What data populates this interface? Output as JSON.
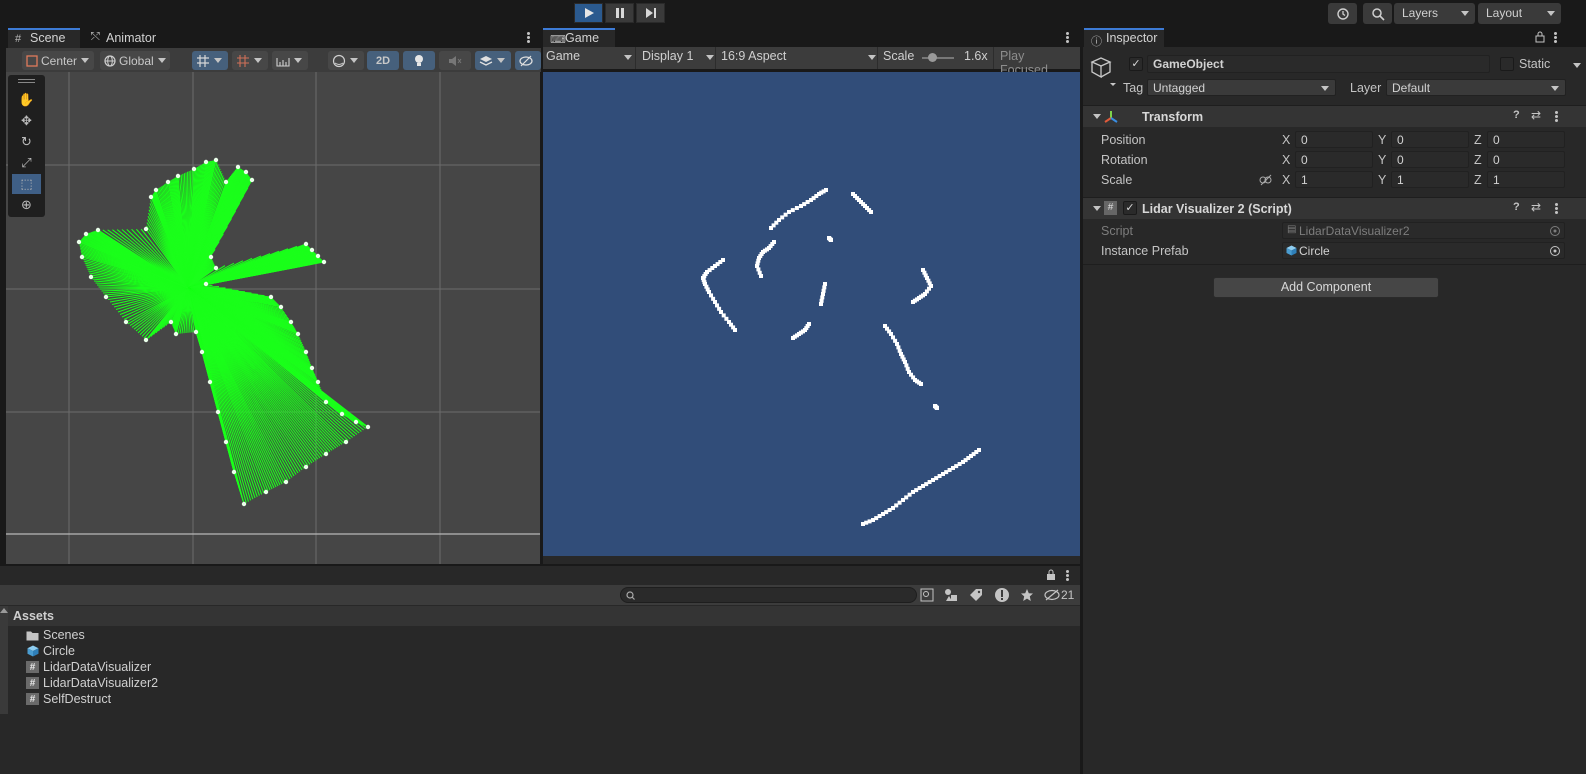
{
  "toolbar": {
    "play_controls": [
      "play",
      "pause",
      "step"
    ],
    "layers_label": "Layers",
    "layout_label": "Layout"
  },
  "scene_panel": {
    "tabs": [
      {
        "label": "Scene",
        "icon": "hash-icon"
      },
      {
        "label": "Animator",
        "icon": "animator-icon"
      }
    ],
    "pivot_label": "Center",
    "space_label": "Global",
    "mode_2d_label": "2D"
  },
  "game_panel": {
    "tab_label": "Game",
    "view_mode": "Game",
    "display": "Display 1",
    "aspect": "16:9 Aspect",
    "scale_label": "Scale",
    "scale_value": "1.6x",
    "play_focused": "Play Focused"
  },
  "inspector": {
    "tab_label": "Inspector",
    "object_name": "GameObject",
    "static_label": "Static",
    "tag_label": "Tag",
    "tag_value": "Untagged",
    "layer_label": "Layer",
    "layer_value": "Default",
    "transform": {
      "title": "Transform",
      "position_label": "Position",
      "rotation_label": "Rotation",
      "scale_label": "Scale",
      "axis_x": "X",
      "axis_y": "Y",
      "axis_z": "Z",
      "position": [
        "0",
        "0",
        "0"
      ],
      "rotation": [
        "0",
        "0",
        "0"
      ],
      "scale": [
        "1",
        "1",
        "1"
      ]
    },
    "script_component": {
      "title": "Lidar Visualizer 2 (Script)",
      "script_label": "Script",
      "script_value": "LidarDataVisualizer2",
      "prefab_label": "Instance Prefab",
      "prefab_value": "Circle"
    },
    "add_component_label": "Add Component"
  },
  "project": {
    "hidden_count": "21",
    "root_label": "Assets",
    "items": [
      {
        "label": "Scenes",
        "icon": "folder-icon"
      },
      {
        "label": "Circle",
        "icon": "prefab-icon"
      },
      {
        "label": "LidarDataVisualizer",
        "icon": "script-icon"
      },
      {
        "label": "LidarDataVisualizer2",
        "icon": "script-icon"
      },
      {
        "label": "SelfDestruct",
        "icon": "script-icon"
      }
    ]
  },
  "colors": {
    "accent": "#3d7bd6",
    "game_background": "#314d79",
    "lidar_rays": "#1aff1a",
    "scene_background": "#464646"
  }
}
